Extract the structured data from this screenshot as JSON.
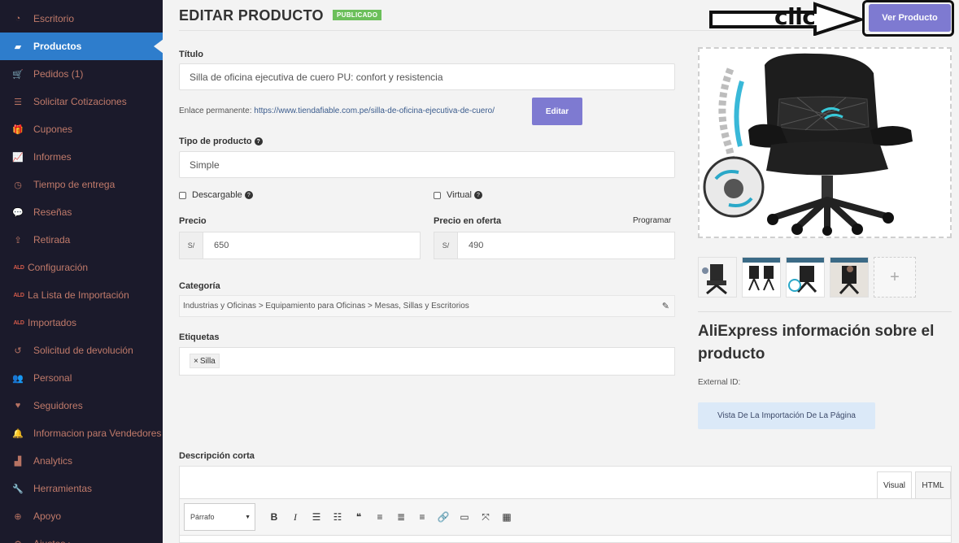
{
  "sidebar": {
    "items": [
      {
        "label": "Escritorio",
        "icon": "dashboard-icon",
        "glyph": "◔"
      },
      {
        "label": "Productos",
        "icon": "briefcase-icon",
        "glyph": "▰",
        "active": true
      },
      {
        "label": "Pedidos (1)",
        "icon": "cart-icon",
        "glyph": "🛒"
      },
      {
        "label": "Solicitar Cotizaciones",
        "icon": "list-icon",
        "glyph": "☰"
      },
      {
        "label": "Cupones",
        "icon": "gift-icon",
        "glyph": "🎁"
      },
      {
        "label": "Informes",
        "icon": "chart-line-icon",
        "glyph": "📈"
      },
      {
        "label": "Tiempo de entrega",
        "icon": "clock-icon",
        "glyph": "◷"
      },
      {
        "label": "Reseñas",
        "icon": "comments-icon",
        "glyph": "💬"
      },
      {
        "label": "Retirada",
        "icon": "upload-icon",
        "glyph": "⇪"
      },
      {
        "label": "Configuración",
        "icon": "aliexpress-logo-icon",
        "glyph": "ALD"
      },
      {
        "label": "La Lista de Importación",
        "icon": "aliexpress-logo-icon",
        "glyph": "ALD"
      },
      {
        "label": "Importados",
        "icon": "aliexpress-logo-icon",
        "glyph": "ALD"
      },
      {
        "label": "Solicitud de devolución",
        "icon": "undo-icon",
        "glyph": "↺"
      },
      {
        "label": "Personal",
        "icon": "users-icon",
        "glyph": "👥"
      },
      {
        "label": "Seguidores",
        "icon": "heart-icon",
        "glyph": "♥"
      },
      {
        "label": "Informacion para Vendedores",
        "icon": "bell-icon",
        "glyph": "🔔"
      },
      {
        "label": "Analytics",
        "icon": "area-chart-icon",
        "glyph": "▟"
      },
      {
        "label": "Herramientas",
        "icon": "wrench-icon",
        "glyph": "🔧"
      },
      {
        "label": "Apoyo",
        "icon": "globe-icon",
        "glyph": "⊕"
      },
      {
        "label": "Ajustes ›",
        "icon": "gear-icon",
        "glyph": "⚙"
      }
    ]
  },
  "header": {
    "title": "EDITAR PRODUCTO",
    "status_badge": "PUBLICADO",
    "view_button": "Ver Producto",
    "annotation": "clic"
  },
  "form": {
    "title_label": "Título",
    "title_value": "Silla de oficina ejecutiva de cuero PU: confort y resistencia",
    "permalink_label": "Enlace permanente:",
    "permalink_url": "https://www.tiendafiable.com.pe/silla-de-oficina-ejecutiva-de-cuero/",
    "edit_button": "Editar",
    "type_label": "Tipo de producto",
    "type_value": "Simple",
    "downloadable_label": "Descargable",
    "virtual_label": "Virtual",
    "price_label": "Precio",
    "price_currency": "S/",
    "price_value": "650",
    "sale_price_label": "Precio en oferta",
    "sale_currency": "S/",
    "sale_price_value": "490",
    "schedule_link": "Programar",
    "category_label": "Categoría",
    "category_value": "Industrias y Oficinas > Equipamiento para Oficinas > Mesas, Sillas y Escritorios",
    "tags_label": "Etiquetas",
    "tag_remove": "×",
    "tag_value": "Silla",
    "short_desc_label": "Descripción corta"
  },
  "aliexpress": {
    "title": "AliExpress información sobre el producto",
    "external_id_label": "External ID:",
    "import_button": "Vista De La Importación De La Página",
    "add_thumb": "+"
  },
  "editor": {
    "tab_visual": "Visual",
    "tab_html": "HTML",
    "format_select": "Párrafo",
    "toolbar": [
      {
        "name": "bold-icon",
        "glyph": "B"
      },
      {
        "name": "italic-icon",
        "glyph": "I"
      },
      {
        "name": "bullet-list-icon",
        "glyph": "☰"
      },
      {
        "name": "numbered-list-icon",
        "glyph": "☷"
      },
      {
        "name": "blockquote-icon",
        "glyph": "❝"
      },
      {
        "name": "align-left-icon",
        "glyph": "≡"
      },
      {
        "name": "align-center-icon",
        "glyph": "≣"
      },
      {
        "name": "align-right-icon",
        "glyph": "≡"
      },
      {
        "name": "link-icon",
        "glyph": "🔗"
      },
      {
        "name": "read-more-icon",
        "glyph": "▭"
      },
      {
        "name": "fullscreen-icon",
        "glyph": "⤧"
      },
      {
        "name": "toolbar-toggle-icon",
        "glyph": "▦"
      }
    ]
  },
  "colors": {
    "sidebar_bg": "#1b1a2b",
    "sidebar_text": "#c07a6a",
    "active_item": "#2e7dcc",
    "primary_button": "#7e7ad1",
    "badge": "#6bbf5a"
  }
}
